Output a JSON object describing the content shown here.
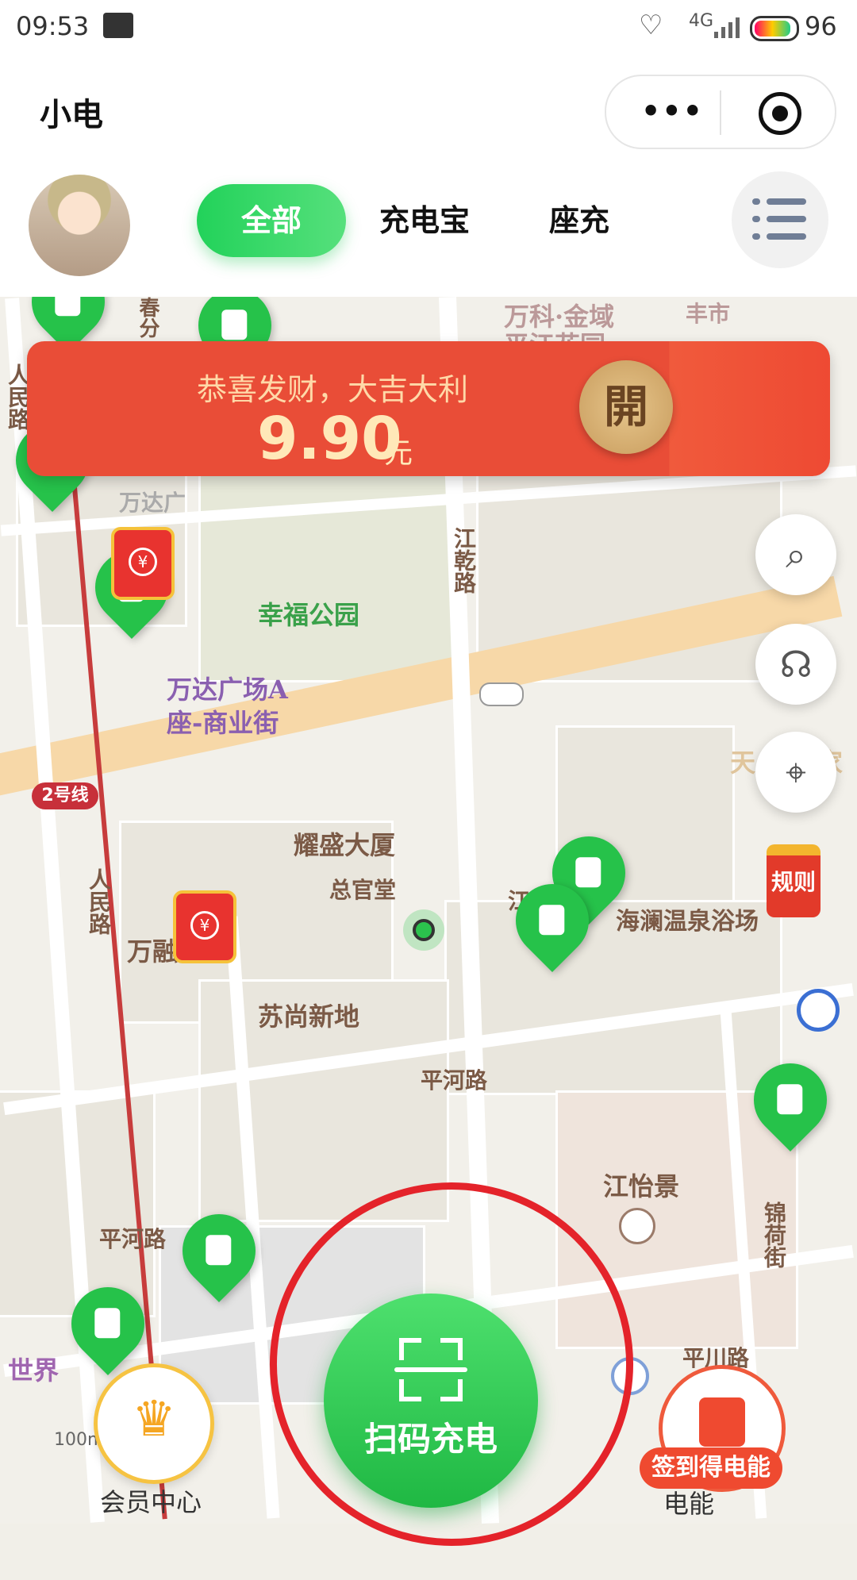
{
  "status_bar": {
    "time": "09:53",
    "network": "4G",
    "battery": "96"
  },
  "title_bar": {
    "title": "小电",
    "more_glyph": "•••"
  },
  "tabs": [
    {
      "label": "全部",
      "active": true
    },
    {
      "label": "充电宝",
      "active": false
    },
    {
      "label": "座充",
      "active": false
    }
  ],
  "banner": {
    "message": "恭喜发财，大吉大利",
    "amount": "9.90",
    "unit": "元",
    "open_label": "開"
  },
  "map": {
    "labels": {
      "park": "幸福公园",
      "wanda_a": "万达广场A",
      "wanda_street": "座-商业街",
      "wanda_top": "万达广",
      "yaosheng": "耀盛大厦",
      "zongguantang": "总官堂",
      "wanrong": "万融国际",
      "sushang": "苏尚新地",
      "hailan": "海澜温泉浴场",
      "pinghe_rd": "平河路",
      "pinghe_rd2": "平河路",
      "pingchuan": "平川路",
      "jiangqian": "江乾路",
      "jiangqian2": "江",
      "renmin": "人民路",
      "renmin2": "人民路",
      "jinhe": "锦荷街",
      "yijing": "江怡景",
      "world": "世界",
      "pingjiang": "平江花园",
      "wanke": "万科·金域",
      "fengshi": "丰市",
      "chunfen": "春分",
      "tian": "天",
      "jia": "家",
      "metro_line": "2号线",
      "scale": "100m"
    },
    "rules_label": "规则"
  },
  "bottom": {
    "scan_label": "扫码充电",
    "member_label": "会员中心",
    "checkin_tag": "签到得电能",
    "energy_label": "电能"
  },
  "colors": {
    "accent": "#26c24a",
    "banner": "#e94d37",
    "highlight": "#e4232a"
  }
}
